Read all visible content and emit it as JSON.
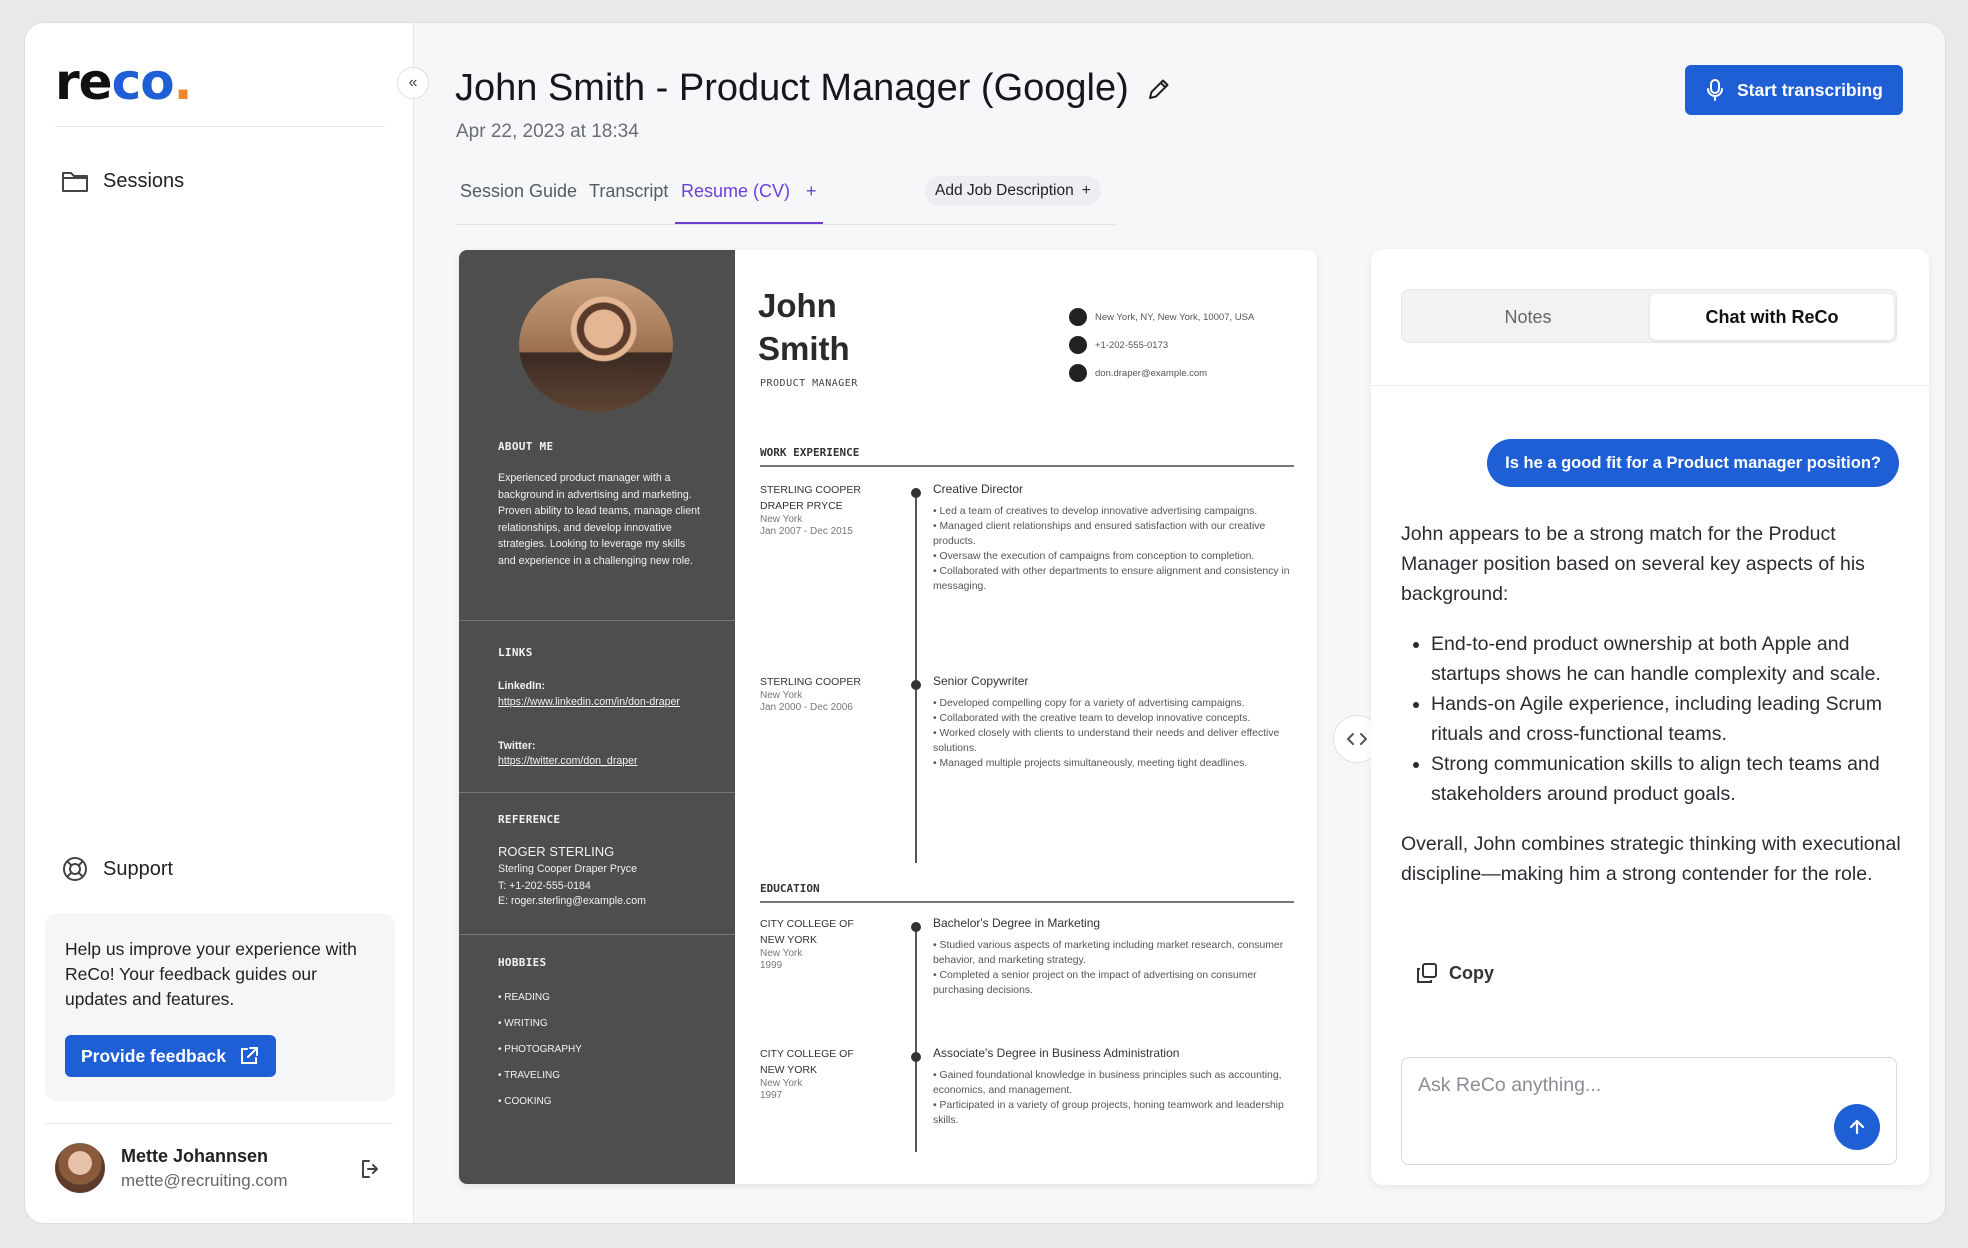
{
  "sidebar": {
    "logo": {
      "part1": "re",
      "part2": "co",
      "dot": "."
    },
    "nav": {
      "sessions": "Sessions",
      "support": "Support"
    },
    "feedback": {
      "text": "Help us improve your experience with ReCo! Your feedback guides our updates and features.",
      "button": "Provide feedback"
    },
    "user": {
      "name": "Mette Johannsen",
      "email": "mette@recruiting.com"
    }
  },
  "header": {
    "title": "John Smith - Product Manager (Google)",
    "date": "Apr 22, 2023 at 18:34",
    "start_button": "Start transcribing"
  },
  "tabs": {
    "guide": "Session Guide",
    "transcript": "Transcript",
    "resume": "Resume (CV)",
    "resume_plus": "+",
    "add_job": "Add Job Description",
    "add_job_plus": "+"
  },
  "resume": {
    "first_name": "John",
    "last_name": "Smith",
    "role": "PRODUCT MANAGER",
    "contact": {
      "address": "New York, NY, New York, 10007, USA",
      "phone": "+1-202-555-0173",
      "email": "don.draper@example.com"
    },
    "about_title": "ABOUT ME",
    "about": "Experienced product manager with a background in advertising and marketing. Proven ability to lead teams, manage client relationships, and develop innovative strategies. Looking to leverage my skills and experience in a challenging new role.",
    "links_title": "LINKS",
    "linkedin_label": "LinkedIn:",
    "linkedin": "https://www.linkedin.com/in/don-draper",
    "twitter_label": "Twitter:",
    "twitter": "https://twitter.com/don_draper",
    "reference_title": "REFERENCE",
    "ref_name": "ROGER STERLING",
    "ref_company": "Sterling Cooper Draper Pryce",
    "ref_phone": "T: +1-202-555-0184",
    "ref_email": "E: roger.sterling@example.com",
    "hobbies_title": "HOBBIES",
    "hobbies": [
      "• READING",
      "• WRITING",
      "• PHOTOGRAPHY",
      "• TRAVELING",
      "• COOKING"
    ],
    "work_title": "WORK EXPERIENCE",
    "jobs": [
      {
        "org": "STERLING COOPER DRAPER PRYCE",
        "place": "New York",
        "dates": "Jan 2007 - Dec 2015",
        "title": "Creative Director",
        "bullets": "• Led a team of creatives to develop innovative advertising campaigns.\n• Managed client relationships and ensured satisfaction with our creative products.\n• Oversaw the execution of campaigns from conception to completion.\n• Collaborated with other departments to ensure alignment and consistency in messaging."
      },
      {
        "org": "STERLING COOPER",
        "place": "New York",
        "dates": "Jan 2000 - Dec 2006",
        "title": "Senior Copywriter",
        "bullets": "• Developed compelling copy for a variety of advertising campaigns.\n• Collaborated with the creative team to develop innovative concepts.\n• Worked closely with clients to understand their needs and deliver effective solutions.\n• Managed multiple projects simultaneously, meeting tight deadlines."
      }
    ],
    "education_title": "EDUCATION",
    "education": [
      {
        "org": "CITY COLLEGE OF NEW YORK",
        "place": "New York",
        "dates": "1999",
        "title": "Bachelor's Degree in Marketing",
        "bullets": "• Studied various aspects of marketing including market research, consumer behavior, and marketing strategy.\n• Completed a senior project on the impact of advertising on consumer purchasing decisions."
      },
      {
        "org": "CITY COLLEGE OF NEW YORK",
        "place": "New York",
        "dates": "1997",
        "title": "Associate's Degree in Business Administration",
        "bullets": "• Gained foundational knowledge in business principles such as accounting, economics, and management.\n• Participated in a variety of group projects, honing teamwork and leadership skills."
      }
    ]
  },
  "chat": {
    "tab_notes": "Notes",
    "tab_chat": "Chat with ReCo",
    "question": "Is he a good fit for a Product manager position?",
    "answer_intro": "John appears to be a strong match for the Product Manager position based on several key aspects of his background:",
    "answer_points": [
      "End-to-end product ownership at both Apple and startups shows he can handle complexity and scale.",
      "Hands-on Agile experience, including leading Scrum rituals and cross-functional teams.",
      "Strong communication skills to align tech teams and stakeholders around product goals."
    ],
    "answer_outro": "Overall, John combines strategic thinking with executional discipline—making him a strong contender for the role.",
    "copy_label": "Copy",
    "input_placeholder": "Ask ReCo anything..."
  },
  "colors": {
    "accent": "#1f5fd6",
    "tab_active": "#6c3ed6",
    "logo_dot": "#f4862a",
    "cv_sidebar": "#4e4e4e"
  }
}
